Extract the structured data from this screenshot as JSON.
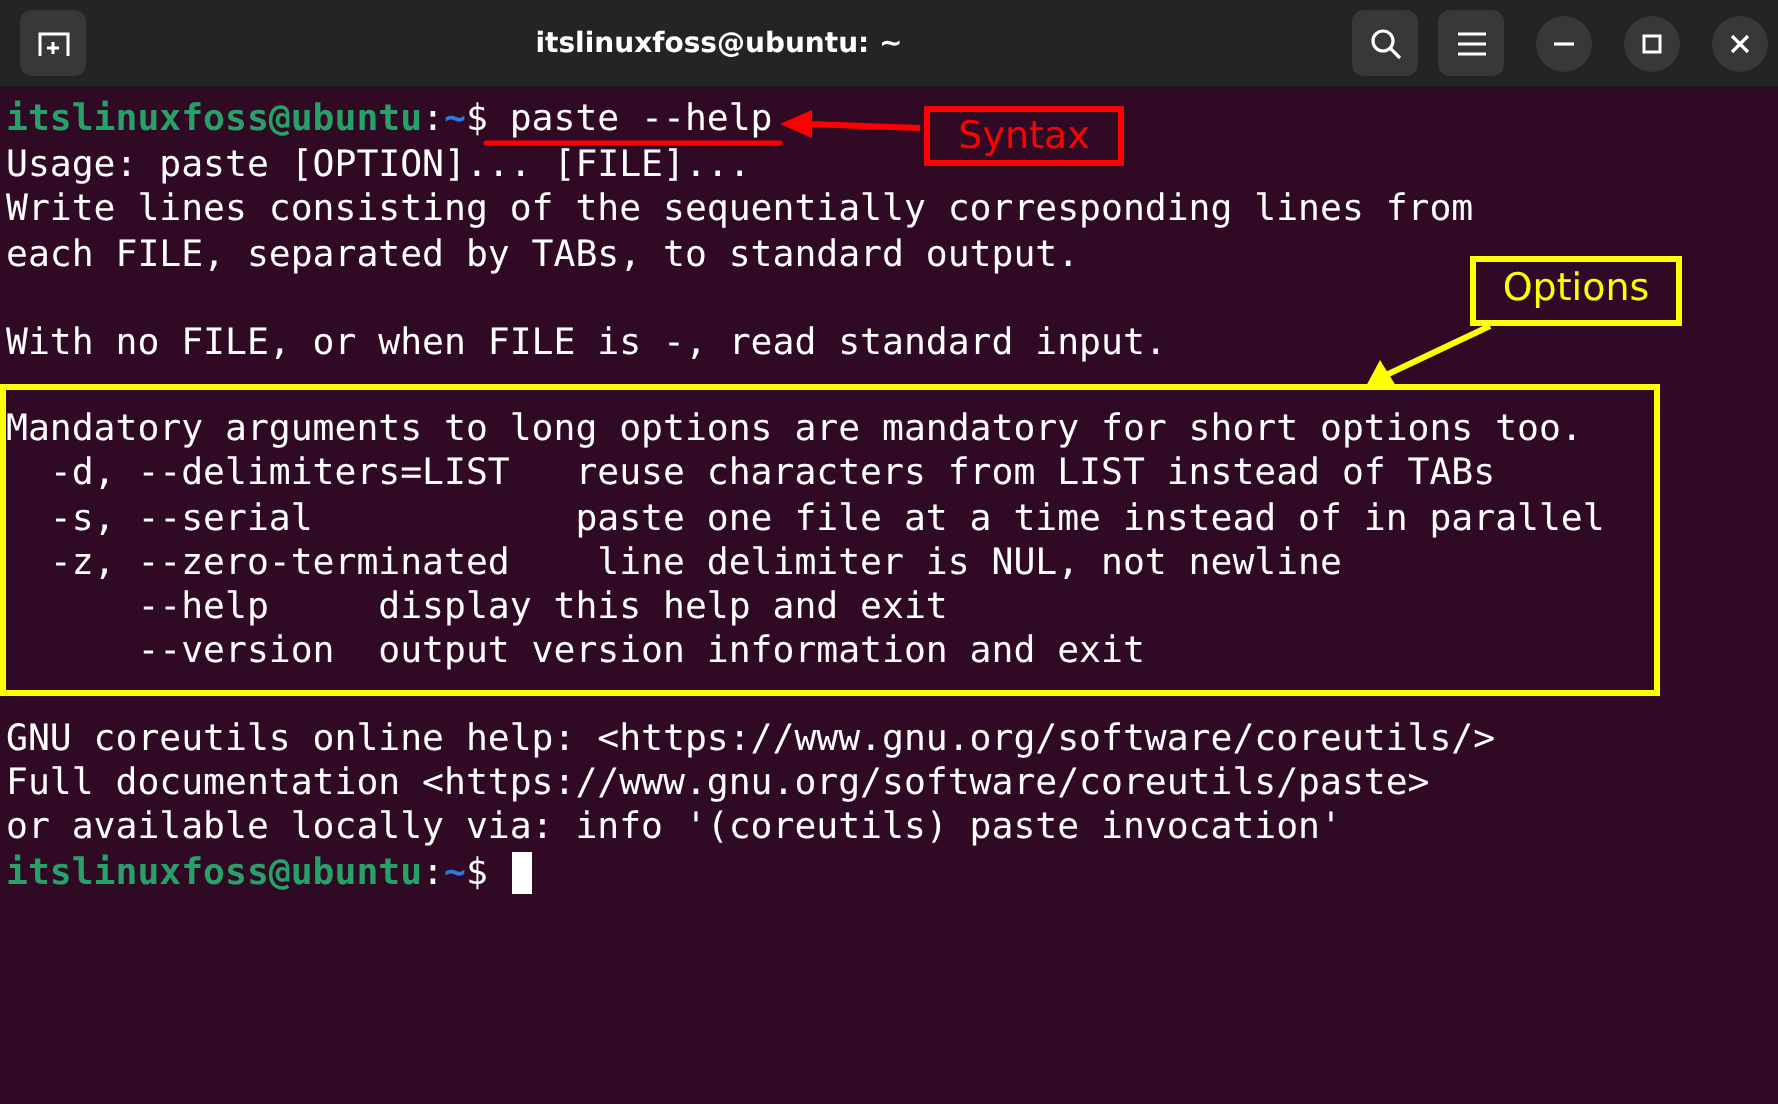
{
  "window": {
    "title": "itslinuxfoss@ubuntu: ~"
  },
  "terminal": {
    "lines": [
      {
        "kind": "prompt",
        "user": "itslinuxfoss@ubuntu",
        "separator": ":",
        "path": "~",
        "sign": "$",
        "command": "paste --help",
        "callout": {
          "kind": "syntax",
          "label": "Syntax"
        }
      },
      {
        "kind": "text",
        "text": "Usage: paste [OPTION]... [FILE]..."
      },
      {
        "kind": "text",
        "text": "Write lines consisting of the sequentially corresponding lines from"
      },
      {
        "kind": "text",
        "text": "each FILE, separated by TABs, to standard output."
      },
      {
        "kind": "blank"
      },
      {
        "kind": "text",
        "text": "With no FILE, or when FILE is -, read standard input."
      },
      {
        "kind": "group",
        "callout": {
          "kind": "options",
          "label": "Options"
        },
        "lines": [
          {
            "kind": "text",
            "text": "Mandatory arguments to long options are mandatory for short options too."
          },
          {
            "kind": "text",
            "text": "  -d, --delimiters=LIST   reuse characters from LIST instead of TABs"
          },
          {
            "kind": "text",
            "text": "  -s, --serial            paste one file at a time instead of in parallel"
          },
          {
            "kind": "text",
            "text": "  -z, --zero-terminated    line delimiter is NUL, not newline"
          },
          {
            "kind": "text",
            "text": "      --help     display this help and exit"
          },
          {
            "kind": "text",
            "text": "      --version  output version information and exit"
          }
        ]
      },
      {
        "kind": "text",
        "text": "GNU coreutils online help: <https://www.gnu.org/software/coreutils/>"
      },
      {
        "kind": "text",
        "text": "Full documentation <https://www.gnu.org/software/coreutils/paste>"
      },
      {
        "kind": "text",
        "text": "or available locally via: info '(coreutils) paste invocation'"
      },
      {
        "kind": "prompt",
        "user": "itslinuxfoss@ubuntu",
        "separator": ":",
        "path": "~",
        "sign": "$",
        "cursor": true
      }
    ]
  }
}
